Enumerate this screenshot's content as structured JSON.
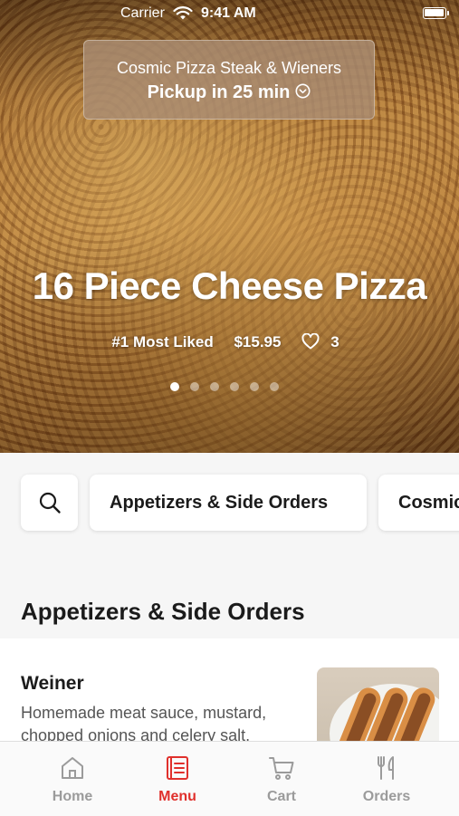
{
  "status_bar": {
    "carrier": "Carrier",
    "time": "9:41 AM"
  },
  "store": {
    "name": "Cosmic Pizza Steak & Wieners",
    "pickup": "Pickup in 25 min"
  },
  "hero": {
    "title": "16 Piece Cheese Pizza",
    "rank": "#1 Most Liked",
    "price": "$15.95",
    "likes": "3",
    "carousel_pages": 6,
    "carousel_active_index": 0
  },
  "categories": {
    "search_icon": "search-icon",
    "items": [
      "Appetizers & Side Orders",
      "Cosmic Pizza"
    ]
  },
  "section": {
    "title": "Appetizers & Side Orders",
    "items": [
      {
        "name": "Weiner",
        "description": "Homemade meat sauce, mustard, chopped onions and celery salt."
      }
    ]
  },
  "tabbar": {
    "items": [
      {
        "label": "Home",
        "icon": "home-icon",
        "active": false
      },
      {
        "label": "Menu",
        "icon": "menu-book-icon",
        "active": true
      },
      {
        "label": "Cart",
        "icon": "cart-icon",
        "active": false
      },
      {
        "label": "Orders",
        "icon": "fork-knife-icon",
        "active": false
      }
    ],
    "active_color": "#e0302c",
    "inactive_color": "#9b9b9b"
  }
}
